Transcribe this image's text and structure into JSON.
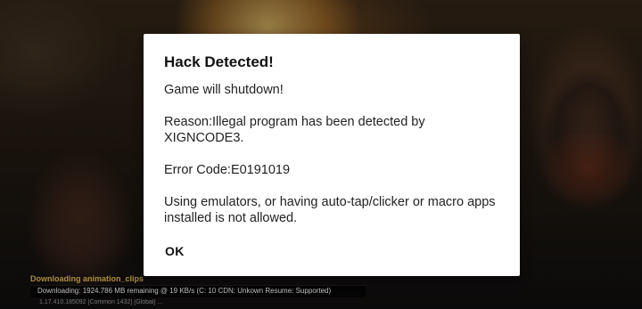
{
  "background": {
    "status_line_1": "Downloading animation_clips",
    "status_line_2": "Downloading: 1924.786 MB remaining @ 19 KB/s     (C: 10  CDN: Unkown  Resume: Supported)",
    "status_line_3": "1.17.410.185092 [Common 1432] [Global] ... "
  },
  "dialog": {
    "title": "Hack Detected!",
    "line1": "Game will shutdown!",
    "line2": "Reason:Illegal program has been detected by XIGNCODE3.",
    "line3": "Error Code:E0191019",
    "line4": "Using emulators, or having auto-tap/clicker or macro apps installed is not allowed.",
    "ok_label": "OK"
  }
}
